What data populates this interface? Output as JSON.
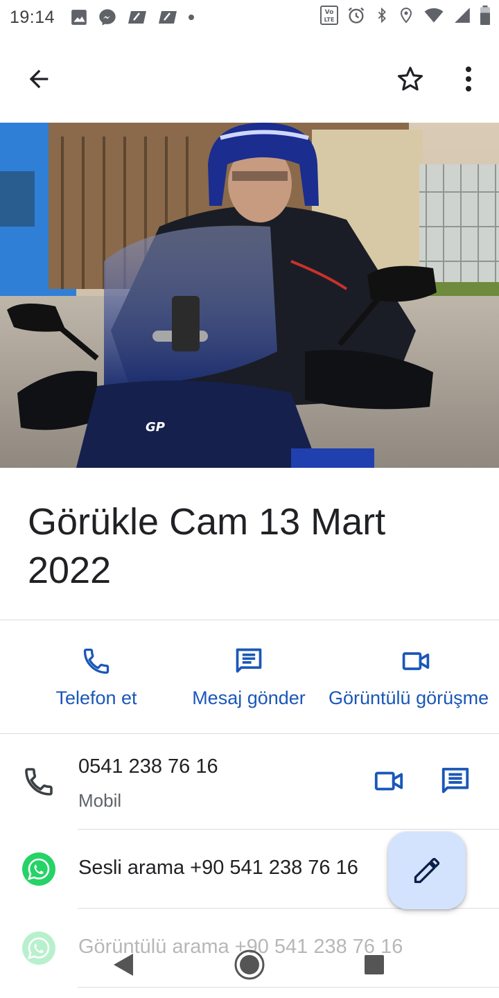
{
  "status_bar": {
    "time": "19:14"
  },
  "app_bar": {
    "back_icon": "arrow-back-icon",
    "star_icon": "star-outline-icon",
    "more_icon": "more-vert-icon"
  },
  "contact": {
    "name": "Görükle Cam 13 Mart 2022"
  },
  "actions": [
    {
      "label": "Telefon et",
      "icon": "phone-icon"
    },
    {
      "label": "Mesaj gönder",
      "icon": "message-icon"
    },
    {
      "label": "Görüntülü görüşme",
      "icon": "videocam-icon"
    }
  ],
  "phone": {
    "number": "0541 238 76 16",
    "type": "Mobil"
  },
  "whatsapp_rows": [
    {
      "label": "Sesli arama +90 541 238 76 16"
    },
    {
      "label": "Görüntülü arama +90 541 238 76 16"
    }
  ],
  "colors": {
    "accent": "#1a57b8",
    "fab_bg": "#d3e3fd",
    "whatsapp": "#25d366"
  }
}
